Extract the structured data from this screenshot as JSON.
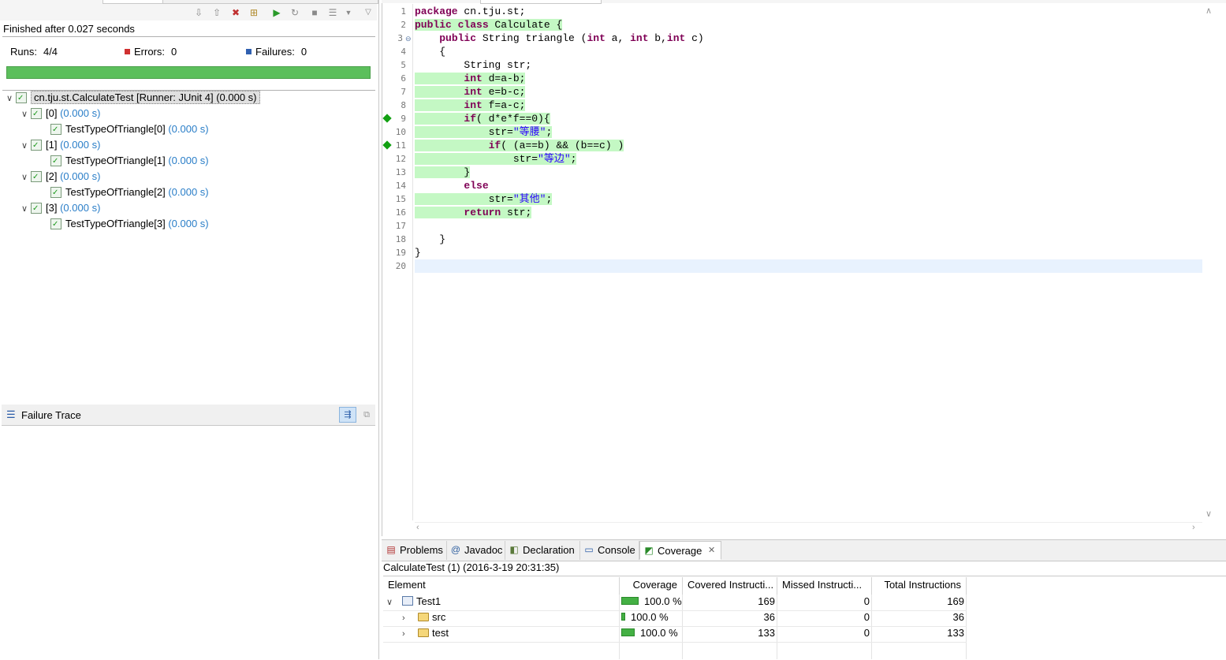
{
  "junit": {
    "status": "Finished after 0.027 seconds",
    "runs_label": "Runs:",
    "runs_value": "4/4",
    "errors_label": "Errors:",
    "errors_value": "0",
    "failures_label": "Failures:",
    "failures_value": "0",
    "progress_fraction": 1.0,
    "progress_color": "#5cbf5c",
    "tree": {
      "root": "cn.tju.st.CalculateTest [Runner: JUnit 4] (0.000 s)",
      "groups": [
        {
          "label": "[0]",
          "time": "(0.000 s)",
          "test": "TestTypeOfTriangle[0]",
          "test_time": "(0.000 s)"
        },
        {
          "label": "[1]",
          "time": "(0.000 s)",
          "test": "TestTypeOfTriangle[1]",
          "test_time": "(0.000 s)"
        },
        {
          "label": "[2]",
          "time": "(0.000 s)",
          "test": "TestTypeOfTriangle[2]",
          "test_time": "(0.000 s)"
        },
        {
          "label": "[3]",
          "time": "(0.000 s)",
          "test": "TestTypeOfTriangle[3]",
          "test_time": "(0.000 s)"
        }
      ]
    },
    "failure_trace_title": "Failure Trace"
  },
  "editor": {
    "line_numbers": [
      "1",
      "2",
      "3",
      "4",
      "5",
      "6",
      "7",
      "8",
      "9",
      "10",
      "11",
      "12",
      "13",
      "14",
      "15",
      "16",
      "17",
      "18",
      "19",
      "20"
    ],
    "lines": {
      "l1_kw": "package",
      "l1_rest": " cn.tju.st;",
      "l2_kw": "public class",
      "l2_rest": " Calculate {",
      "l3_kw1": "public",
      "l3_a": " String triangle (",
      "l3_kw2": "int",
      "l3_b": " a, ",
      "l3_kw3": "int",
      "l3_c": " b,",
      "l3_kw4": "int",
      "l3_d": " c)",
      "l4": "{",
      "l5": "String str;",
      "l6_kw": "int",
      "l6_rest": " d=a-b;",
      "l7_kw": "int",
      "l7_rest": " e=b-c;",
      "l8_kw": "int",
      "l8_rest": " f=a-c;",
      "l9_kw": "if",
      "l9_rest": "( d*e*f==0){",
      "l10_a": "str=",
      "l10_s": "\"等腰\"",
      "l10_b": ";",
      "l11_kw": "if",
      "l11_rest": "( (a==b) && (b==c) )",
      "l12_a": "str=",
      "l12_s": "\"等边\"",
      "l12_b": ";",
      "l13": "}",
      "l14_kw": "else",
      "l15_a": "str=",
      "l15_s": "\"其他\"",
      "l15_b": ";",
      "l16_kw": "return",
      "l16_rest": " str;",
      "l18": "}",
      "l19": "}"
    }
  },
  "views": {
    "tabs": [
      "Problems",
      "Javadoc",
      "Declaration",
      "Console",
      "Coverage"
    ],
    "active_tab": "Coverage",
    "session": "CalculateTest (1) (2016-3-19 20:31:35)",
    "columns": [
      "Element",
      "Coverage",
      "Covered Instructi...",
      "Missed Instructi...",
      "Total Instructions"
    ],
    "rows": [
      {
        "element": "Test1",
        "coverage": "100.0 %",
        "covered": "169",
        "missed": "0",
        "total": "169",
        "bar_fraction": 1.0
      },
      {
        "element": "src",
        "coverage": "100.0 %",
        "covered": "36",
        "missed": "0",
        "total": "36",
        "bar_fraction": 0.21
      },
      {
        "element": "test",
        "coverage": "100.0 %",
        "covered": "133",
        "missed": "0",
        "total": "133",
        "bar_fraction": 0.79
      }
    ]
  }
}
